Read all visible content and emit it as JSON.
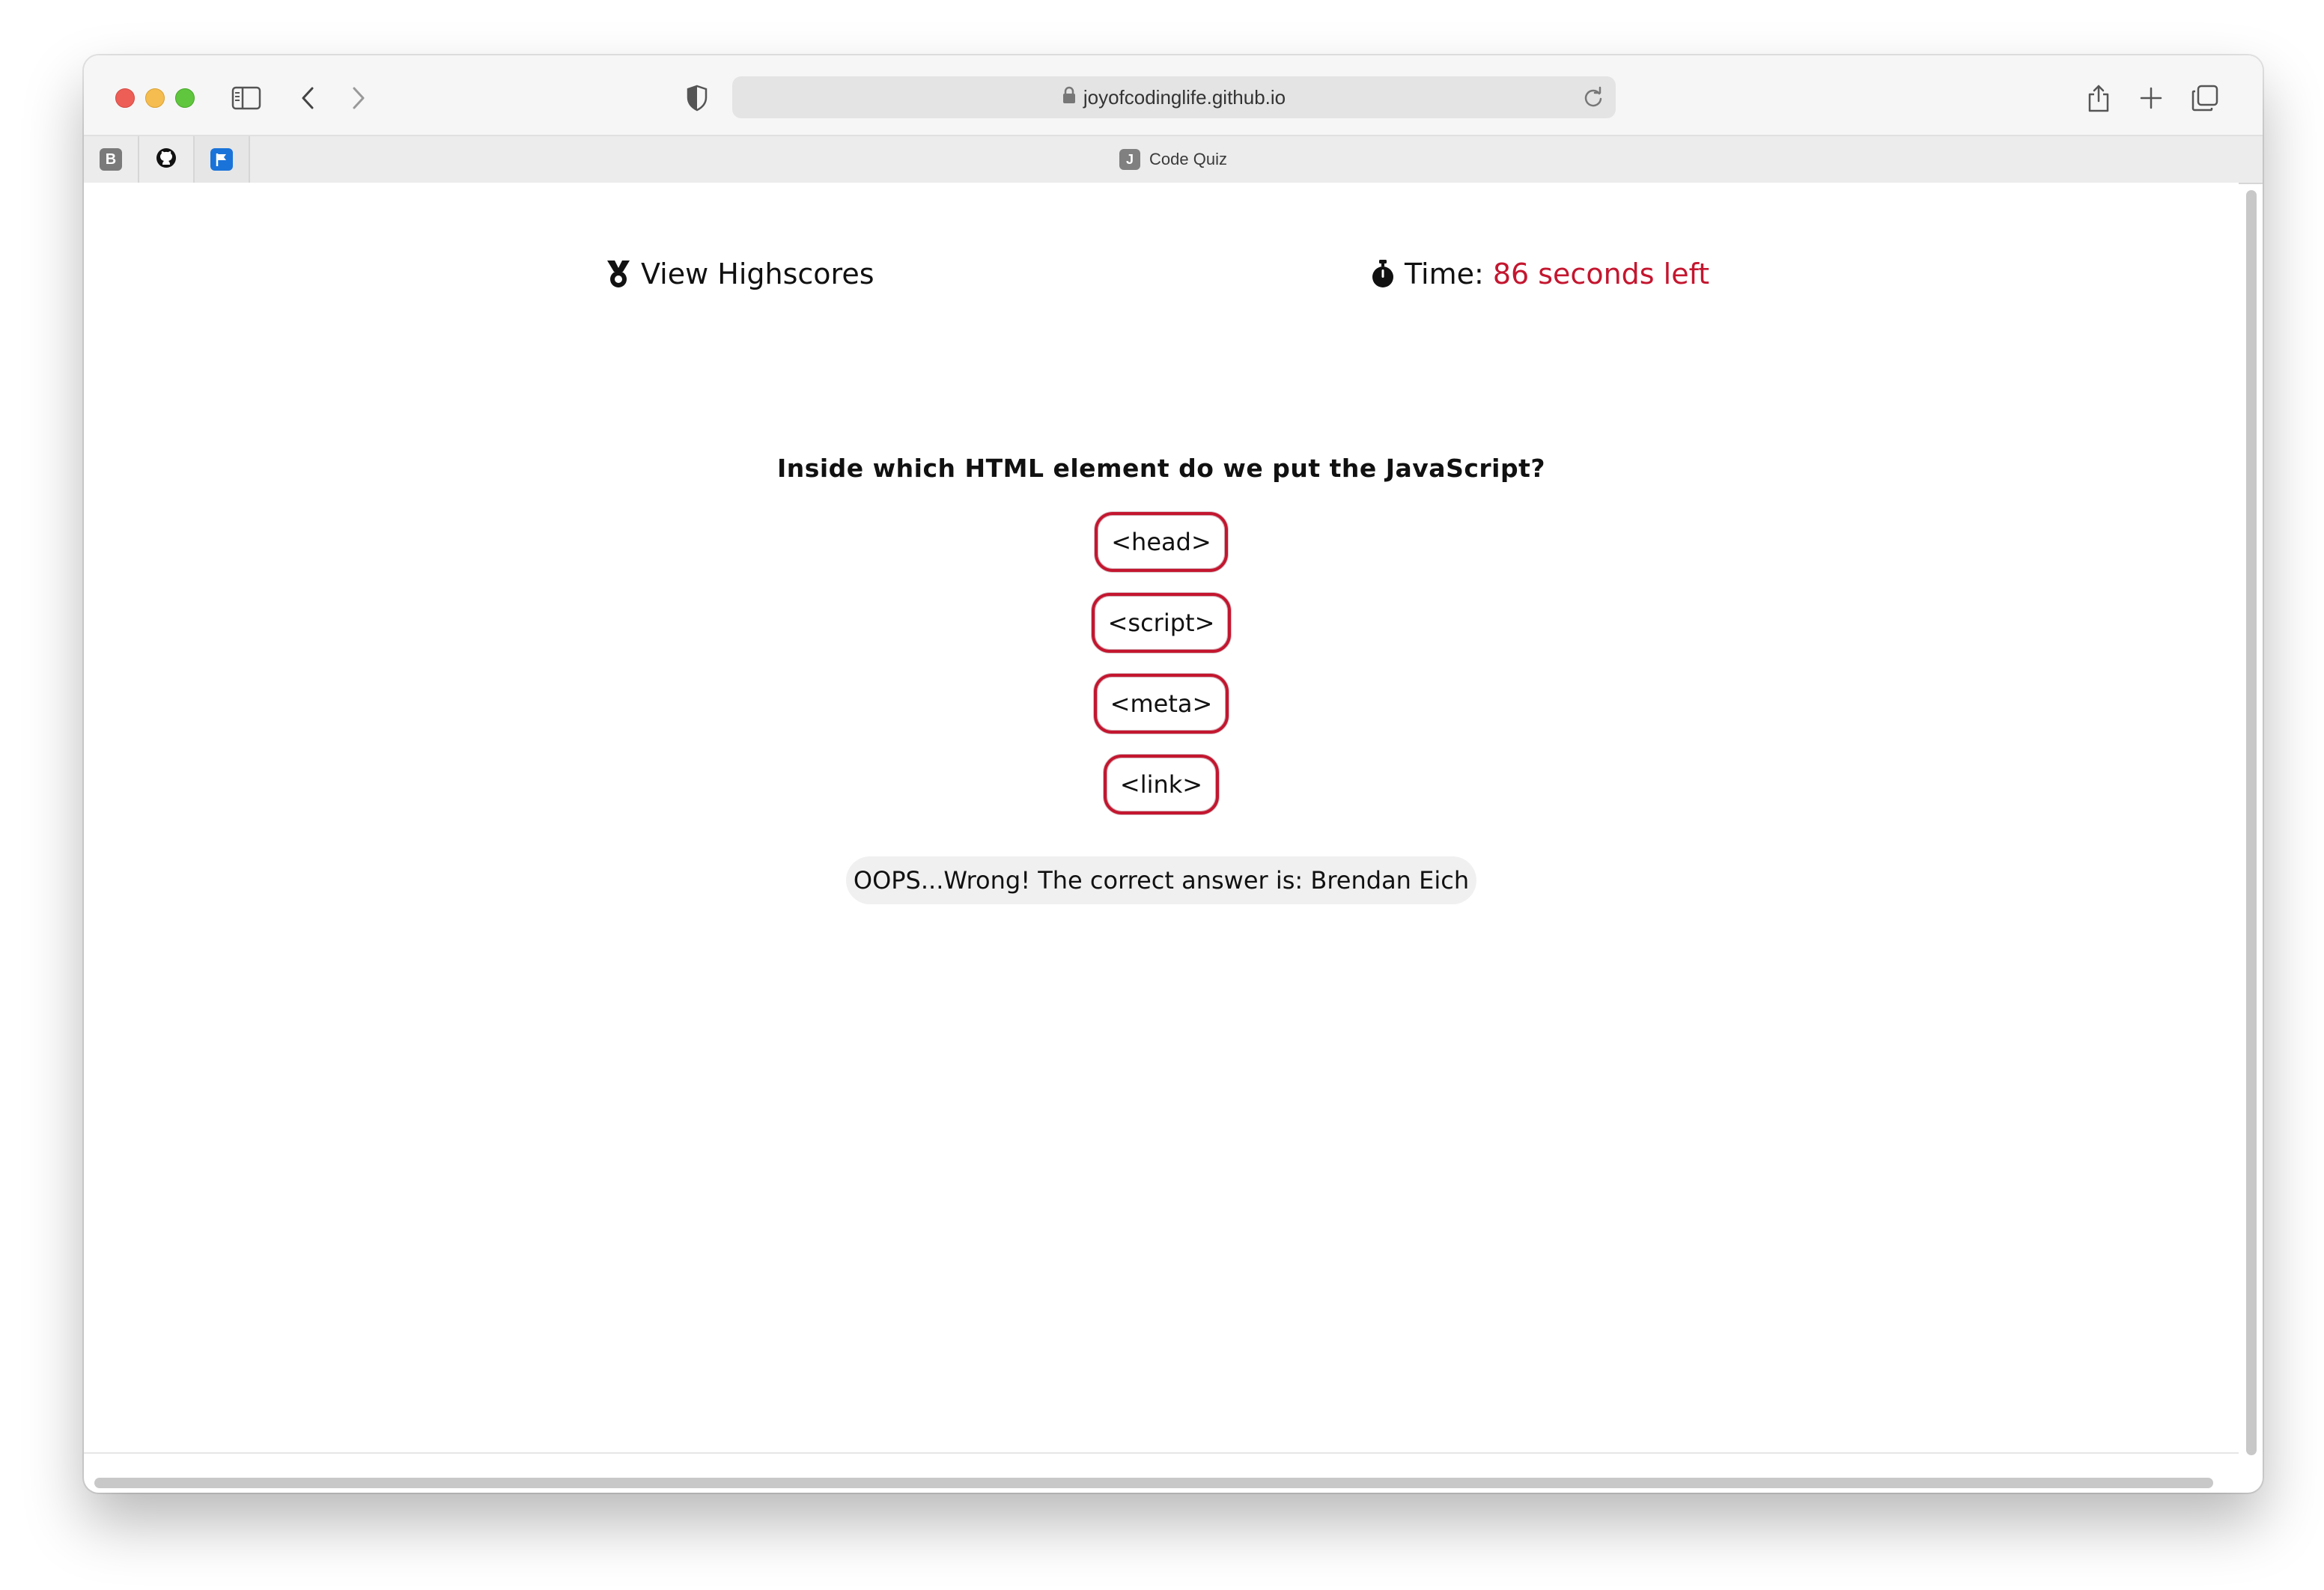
{
  "browser": {
    "url": "joyofcodinglife.github.io",
    "tab_title": "Code Quiz",
    "tab_favicon_letter": "J",
    "favorites": [
      {
        "name": "bootstrap",
        "letter": "B",
        "color": "#7a7a7a"
      },
      {
        "name": "github",
        "letter": "",
        "color": "#111111"
      },
      {
        "name": "flag",
        "letter": "",
        "color": "#1a73d9"
      }
    ]
  },
  "header": {
    "highscores_label": "View Highscores",
    "time_label": "Time:",
    "time_value": "86 seconds left"
  },
  "quiz": {
    "question": "Inside which HTML element do we put the JavaScript?",
    "answers": [
      "<head>",
      "<script>",
      "<meta>",
      "<link>"
    ],
    "feedback": "OOPS...Wrong! The correct answer is: Brendan Eich"
  },
  "colors": {
    "accent": "#c4162f"
  }
}
